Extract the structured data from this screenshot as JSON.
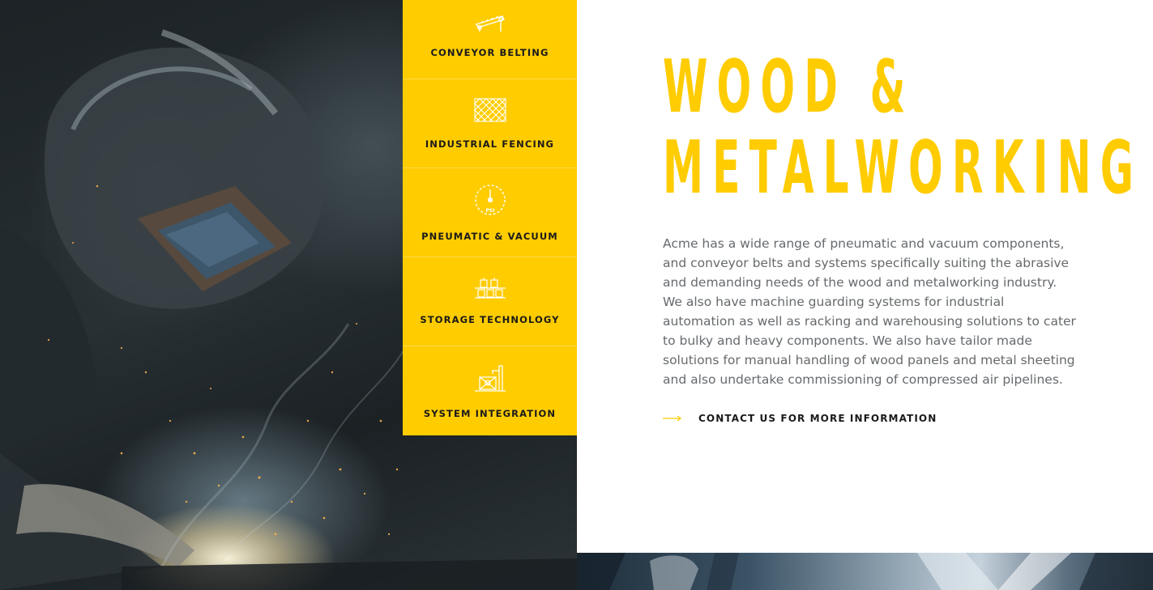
{
  "nav": {
    "items": [
      {
        "label": "CONVEYOR BELTING",
        "icon": "conveyor-icon"
      },
      {
        "label": "INDUSTRIAL FENCING",
        "icon": "fence-mesh-icon"
      },
      {
        "label": "PNEUMATIC & VACUUM",
        "icon": "pressure-gauge-icon",
        "icon_text": "PSI"
      },
      {
        "label": "STORAGE TECHNOLOGY",
        "icon": "storage-rack-icon"
      },
      {
        "label": "SYSTEM INTEGRATION",
        "icon": "system-integration-icon"
      }
    ]
  },
  "hero": {
    "title_line1": "WOOD &",
    "title_line2": "METALWORKING",
    "body": "Acme has a wide range of pneumatic and vacuum components, and conveyor belts and systems specifically suiting the abrasive and demanding needs of the wood and metalworking industry. We also have machine guarding systems for industrial automation as well as racking and warehousing solutions to cater to bulky and heavy components. We also have tailor made solutions for manual handling of wood panels and metal sheeting and also undertake commissioning of compressed air pipelines.",
    "cta_label": "CONTACT US FOR MORE INFORMATION"
  },
  "colors": {
    "accent": "#ffcc00",
    "text": "#666a6d",
    "dark": "#1a1a1a"
  }
}
